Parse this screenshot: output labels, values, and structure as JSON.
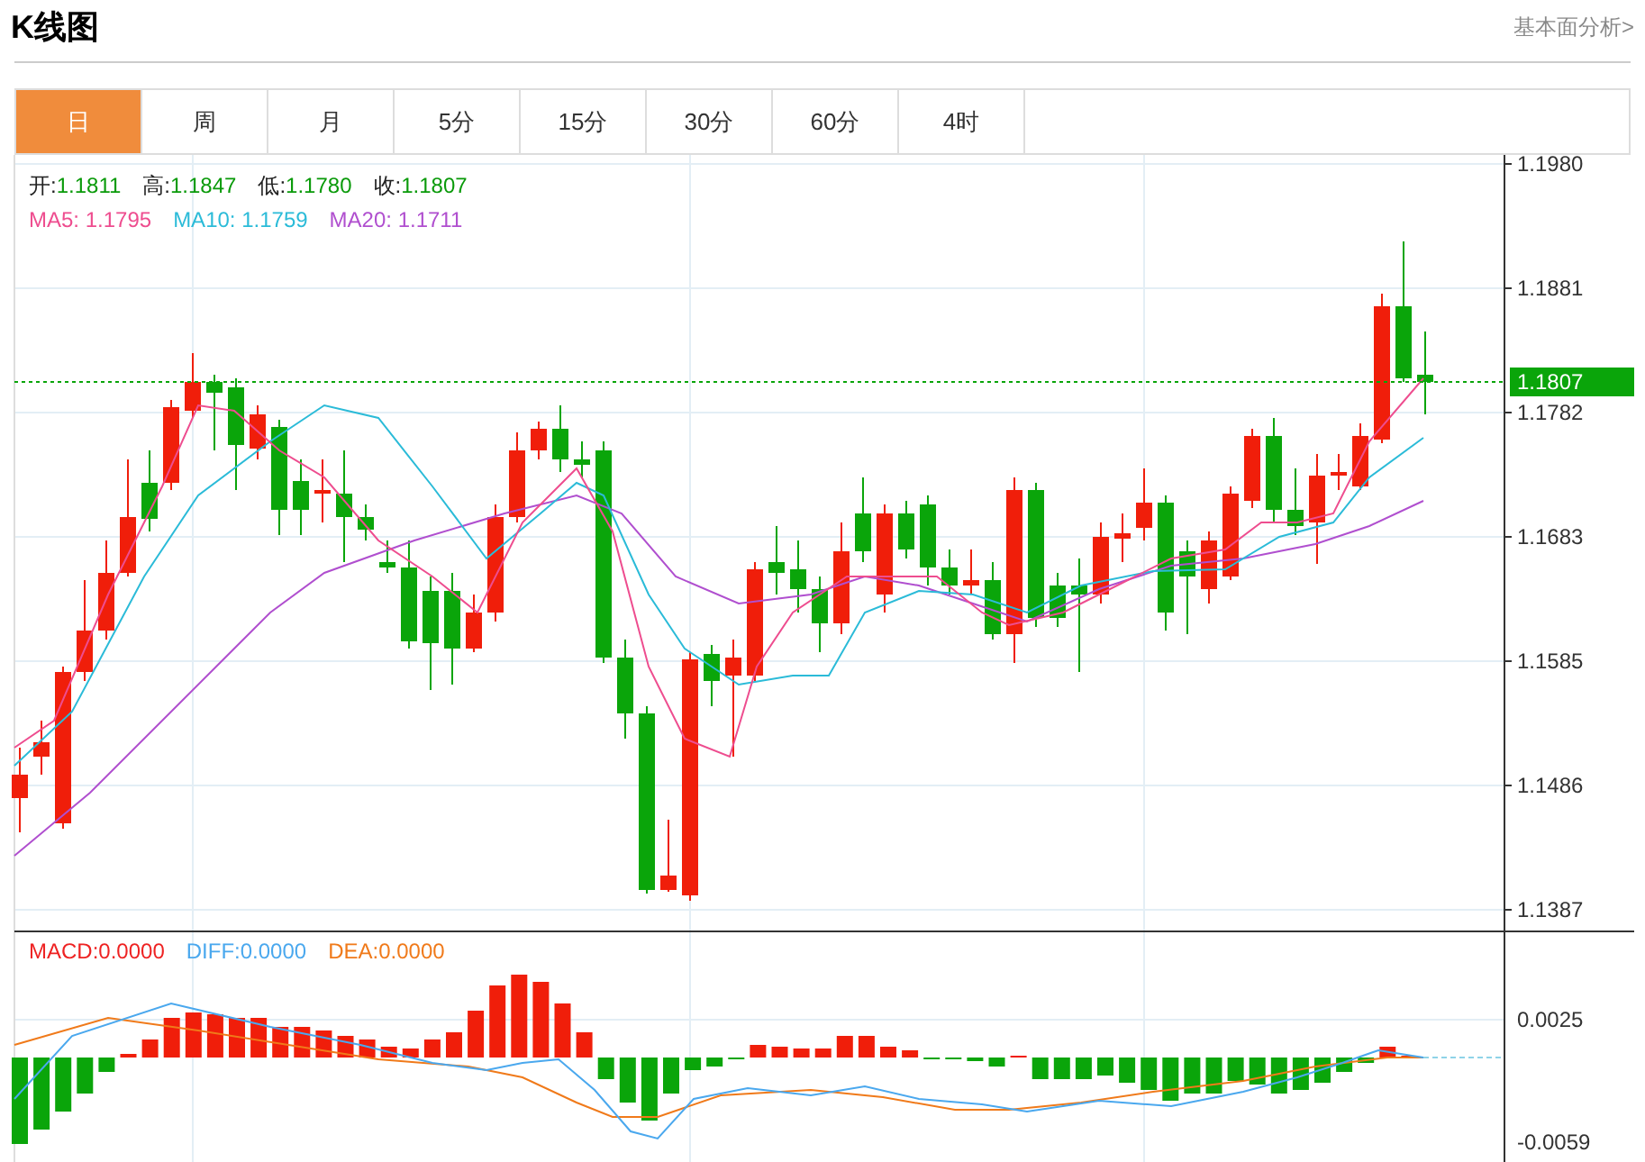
{
  "title": "K线图",
  "analysis_link": "基本面分析>",
  "tabs": [
    {
      "label": "日",
      "selected": true
    },
    {
      "label": "周",
      "selected": false
    },
    {
      "label": "月",
      "selected": false
    },
    {
      "label": "5分",
      "selected": false
    },
    {
      "label": "15分",
      "selected": false
    },
    {
      "label": "30分",
      "selected": false
    },
    {
      "label": "60分",
      "selected": false
    },
    {
      "label": "4时",
      "selected": false
    }
  ],
  "ohlc_legend": [
    {
      "label": "开:",
      "value": "1.1811"
    },
    {
      "label": "高:",
      "value": "1.1847"
    },
    {
      "label": "低:",
      "value": "1.1780"
    },
    {
      "label": "收:",
      "value": "1.1807"
    }
  ],
  "ma_legend": [
    {
      "label": "MA5:",
      "value": "1.1795",
      "color": "#ee4d8f"
    },
    {
      "label": "MA10:",
      "value": "1.1759",
      "color": "#2bbbd8"
    },
    {
      "label": "MA20:",
      "value": "1.1711",
      "color": "#b04fcf"
    }
  ],
  "price_axis": [
    "1.1980",
    "1.1881",
    "1.1782",
    "1.1683",
    "1.1585",
    "1.1486",
    "1.1387"
  ],
  "current_price": "1.1807",
  "macd_legend": [
    {
      "label": "MACD:",
      "value": "0.0000",
      "color": "#ee2222"
    },
    {
      "label": "DIFF:",
      "value": "0.0000",
      "color": "#4aa8ee"
    },
    {
      "label": "DEA:",
      "value": "0.0000",
      "color": "#f07a1a"
    }
  ],
  "macd_axis": [
    "0.0025",
    "-0.0059"
  ]
}
